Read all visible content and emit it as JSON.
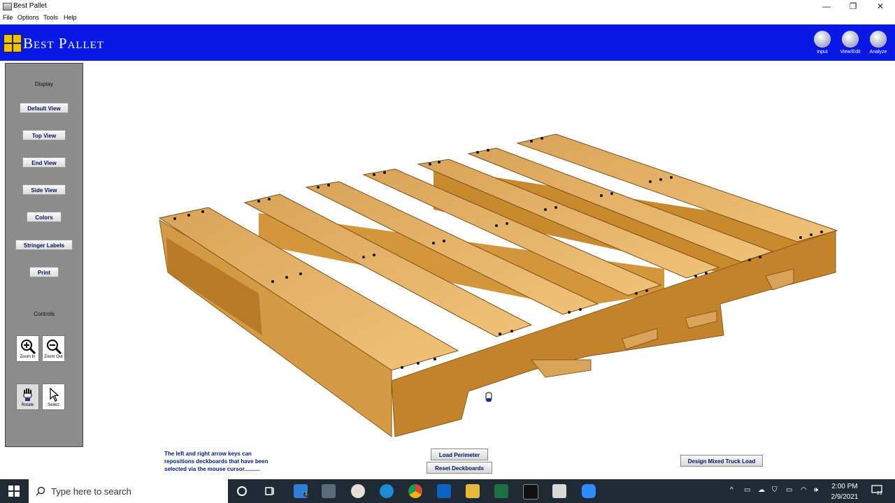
{
  "window": {
    "title": "Best Pallet",
    "minimize": "—",
    "restore": "❐",
    "close": "✕"
  },
  "menu": [
    "File",
    "Options",
    "Tools",
    "Help"
  ],
  "header": {
    "brand": "Best Pallet",
    "buttons": [
      {
        "label": "Input"
      },
      {
        "label": "View/Edit"
      },
      {
        "label": "Analyze"
      }
    ]
  },
  "sidebar": {
    "display_heading": "Display",
    "buttons": [
      "Default View",
      "Top View",
      "End View",
      "Side View",
      "Colors",
      "Stringer Labels",
      "Print"
    ],
    "controls_heading": "Controls",
    "controls": [
      {
        "label": "Zoom In",
        "icon": "zoom-in-icon"
      },
      {
        "label": "Zoom Out",
        "icon": "zoom-out-icon"
      },
      {
        "label": "Rotate",
        "icon": "hand-icon"
      },
      {
        "label": "Select",
        "icon": "pointer-icon"
      }
    ]
  },
  "help_text": "The left and right arrow keys can repositions deckboards that have been selected via the mouse cursor..........",
  "bottom_buttons": {
    "load_perimeter": "Load Perimeter",
    "reset_deckboards": "Reset Deckboards",
    "design_mixed": "Design Mixed Truck Load"
  },
  "colors": {
    "header": "#0a18e6",
    "wood_top": "#e2b36a",
    "wood_side": "#c98a2e",
    "wood_dark": "#a86f20"
  },
  "taskbar": {
    "search_placeholder": "Type here to search",
    "time": "2:00 PM",
    "date": "2/9/2021",
    "notification_count": "21",
    "mail_badge": "1"
  }
}
